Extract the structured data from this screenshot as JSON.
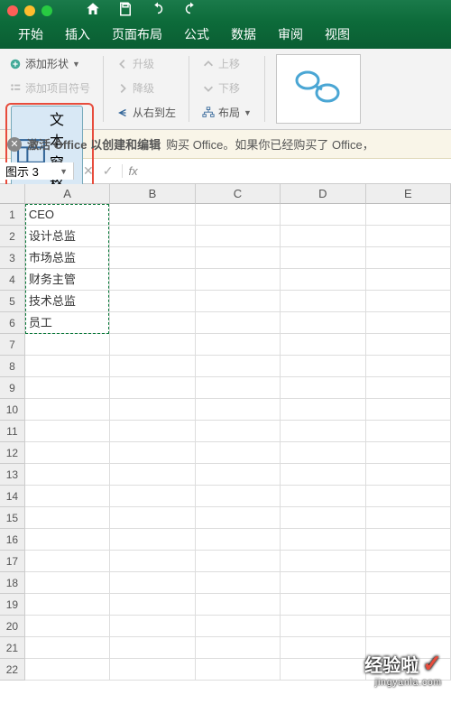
{
  "tabs": {
    "start": "开始",
    "insert": "插入",
    "layout": "页面布局",
    "formulas": "公式",
    "data": "数据",
    "review": "审阅",
    "view": "视图"
  },
  "ribbon": {
    "add_shape": "添加形状",
    "add_bullet": "添加项目符号",
    "text_pane": "文本窗格",
    "promote": "升级",
    "demote": "降级",
    "rtl": "从右到左",
    "move_up": "上移",
    "move_down": "下移",
    "layout_btn": "布局"
  },
  "msgbar": {
    "title": "激活 Office 以创建和编辑",
    "body": "购买 Office。如果你已经购买了 Office，"
  },
  "namebox": "图示 3",
  "fx": "fx",
  "columns": [
    "A",
    "B",
    "C",
    "D",
    "E"
  ],
  "cells": {
    "a1": "CEO",
    "a2": "设计总监",
    "a3": "市场总监",
    "a4": "财务主管",
    "a5": "技术总监",
    "a6": "员工"
  },
  "rownums": [
    "1",
    "2",
    "3",
    "4",
    "5",
    "6",
    "7",
    "8",
    "9",
    "10",
    "11",
    "12",
    "13",
    "14",
    "15",
    "16",
    "17",
    "18",
    "19",
    "20",
    "21",
    "22"
  ],
  "watermark": {
    "main": "经验啦",
    "sub": "jingyanla.com"
  }
}
